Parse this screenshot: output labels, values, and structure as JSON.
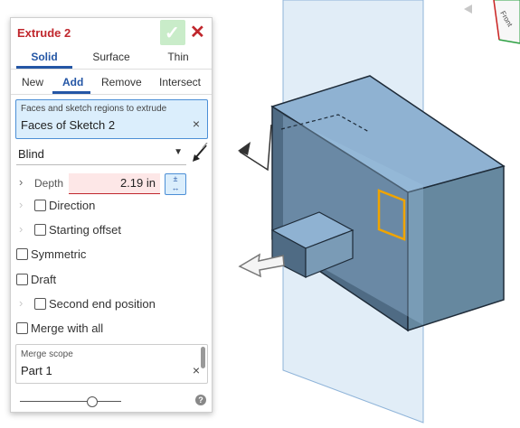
{
  "viewcube": {
    "face_label": "Front"
  },
  "dialog": {
    "title": "Extrude 2",
    "confirm_icon": "check-icon",
    "cancel_icon": "close-icon",
    "accent_color": "#c0272d",
    "selected_color": "#2456a5",
    "tabs": [
      "Solid",
      "Surface",
      "Thin"
    ],
    "selected_tab": "Solid",
    "operations": [
      "New",
      "Add",
      "Remove",
      "Intersect"
    ],
    "selected_operation": "Add",
    "faces": {
      "label": "Faces and sketch regions to extrude",
      "value": "Faces of Sketch 2",
      "clear": "×"
    },
    "end_type": {
      "value": "Blind"
    },
    "depth": {
      "label": "Depth",
      "value": "2.19 in"
    },
    "direction": {
      "label": "Direction"
    },
    "starting_offset": {
      "label": "Starting offset"
    },
    "symmetric": {
      "label": "Symmetric"
    },
    "draft": {
      "label": "Draft"
    },
    "second_end": {
      "label": "Second end position"
    },
    "merge_with_all": {
      "label": "Merge with all"
    },
    "merge_scope": {
      "label": "Merge scope",
      "value": "Part 1",
      "clear": "×"
    },
    "help": "?"
  }
}
